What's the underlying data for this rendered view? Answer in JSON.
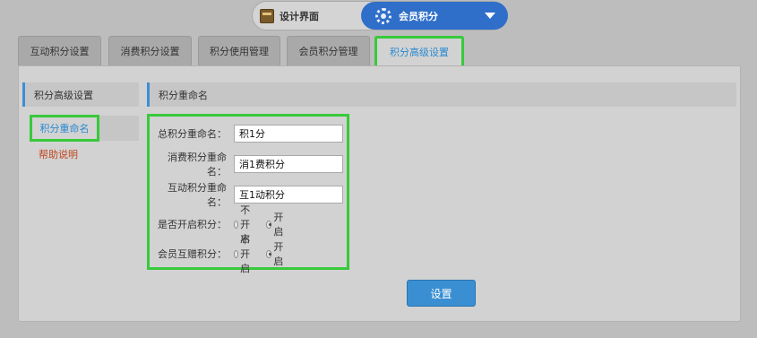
{
  "header": {
    "left_label": "设计界面",
    "right_label": "会员积分",
    "left_icon": "design-icon",
    "right_icon": "gear-icon"
  },
  "tabs": [
    {
      "label": "互动积分设置",
      "active": false
    },
    {
      "label": "消费积分设置",
      "active": false
    },
    {
      "label": "积分使用管理",
      "active": false
    },
    {
      "label": "会员积分管理",
      "active": false
    },
    {
      "label": "积分高级设置",
      "active": true
    }
  ],
  "sidebar": {
    "title": "积分高级设置",
    "items": [
      {
        "label": "积分重命名",
        "active": true
      },
      {
        "label": "帮助说明",
        "active": false
      }
    ]
  },
  "main": {
    "title": "积分重命名",
    "fields": [
      {
        "label": "总积分重命名：",
        "value": "积1分"
      },
      {
        "label": "消费积分重命名：",
        "value": "消1费积分"
      },
      {
        "label": "互动积分重命名：",
        "value": "互1动积分"
      }
    ],
    "toggles": [
      {
        "label": "是否开启积分：",
        "off_label": "不开启",
        "on_label": "开启",
        "selected": "on"
      },
      {
        "label": "会员互赠积分：",
        "off_label": "不开启",
        "on_label": "开启",
        "selected": "on"
      }
    ],
    "submit_label": "设置"
  },
  "colors": {
    "accent": "#3a8fd3",
    "highlight": "#38c93b",
    "link_active": "#2a8ad0",
    "link_help": "#c0461f"
  }
}
